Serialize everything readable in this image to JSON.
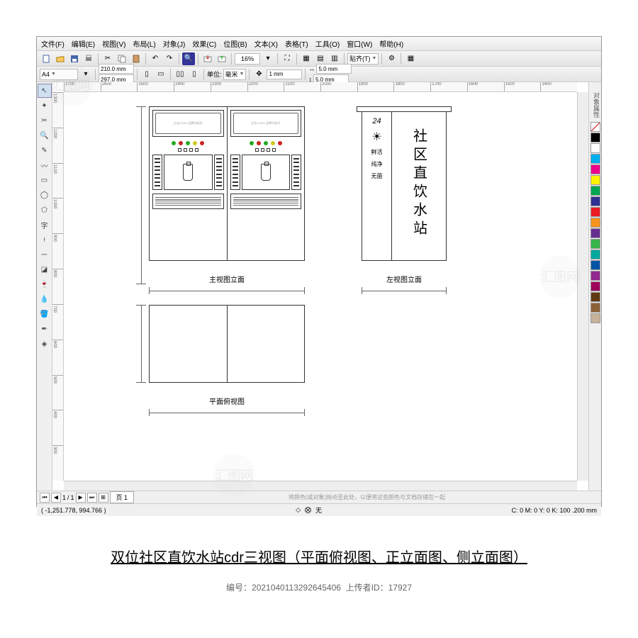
{
  "menubar": [
    "文件(F)",
    "编辑(E)",
    "视图(V)",
    "布局(L)",
    "对象(J)",
    "效果(C)",
    "位图(B)",
    "文本(X)",
    "表格(T)",
    "工具(O)",
    "窗口(W)",
    "帮助(H)"
  ],
  "toolbar1": {
    "zoom": "16%",
    "snap_label": "贴齐(T)"
  },
  "toolbar2": {
    "page_size": "A4",
    "width": "210.0 mm",
    "height": "297.0 mm",
    "unit_label": "单位:",
    "unit_value": "毫米",
    "nudge": "1 mm",
    "dup_x": "5.0 mm",
    "dup_y": "5.0 mm"
  },
  "ruler_h": [
    "2700",
    "2600",
    "2500",
    "2400",
    "2300",
    "2200",
    "2100",
    "2000",
    "1900",
    "1800",
    "1700",
    "1600",
    "1500",
    "1400"
  ],
  "ruler_v": [
    "1300",
    "1200",
    "1100",
    "1000",
    "900",
    "800",
    "700",
    "600",
    "500",
    "400",
    "300"
  ],
  "drawing": {
    "front_label": "主视图立面",
    "side_label": "左视图立面",
    "top_label": "平面俯视图",
    "screen_text": "企业LOGO 品牌与标识",
    "side_title": "社区直饮水站",
    "side_24": "24",
    "side_words": [
      "鲜活",
      "纯净",
      "无菌"
    ]
  },
  "palette": [
    "#000000",
    "#ffffff",
    "#00aeef",
    "#ec008c",
    "#fff200",
    "#00a651",
    "#2e3192",
    "#ed1c24",
    "#f7941d",
    "#662d91",
    "#39b54a",
    "#00a99d",
    "#0054a6",
    "#92278f",
    "#9e005d",
    "#603913",
    "#8c6239",
    "#c7b299"
  ],
  "pager": {
    "current": "1",
    "total": "1",
    "tab": "页 1",
    "hint": "将颜色(或对象)拖动至此处，以便将这些颜色与文档存储在一起"
  },
  "status": {
    "coords": "( -1,251.778, 994.766 )",
    "right": "C: 0 M: 0 Y: 0 K: 100   .200 mm",
    "fill": "无"
  },
  "caption": "双位社区直饮水站cdr三视图（平面俯视图、正立面图、侧立面图）",
  "meta": {
    "id_label": "编号：",
    "id": "2021040113292645406",
    "uploader_label": "上传者ID：",
    "uploader": "17927"
  },
  "docker_tab": "对象属性"
}
